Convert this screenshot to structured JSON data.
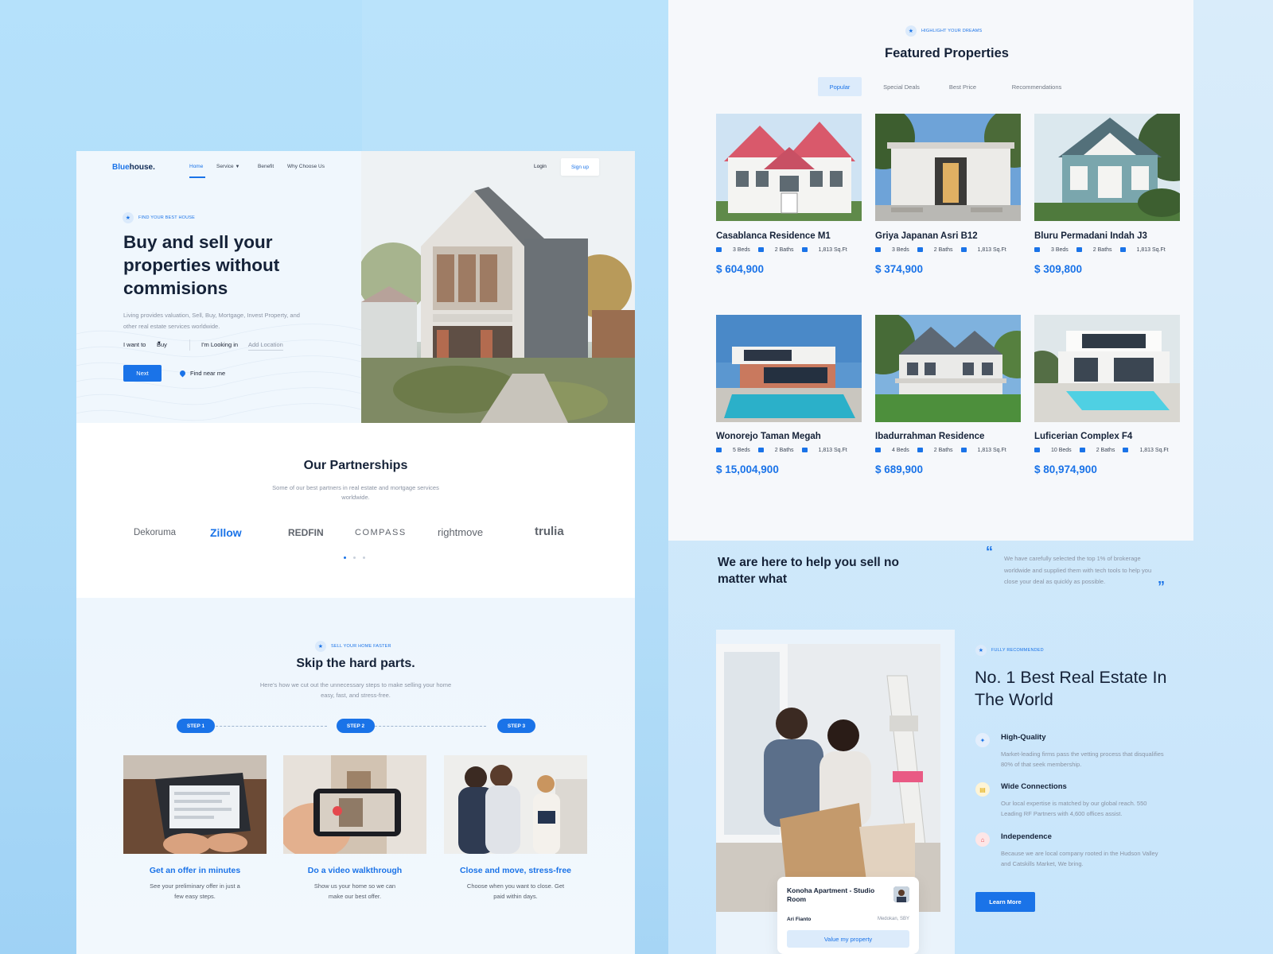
{
  "nav": {
    "logo_prefix": "Blue",
    "logo_suffix": "house.",
    "items": [
      "Home",
      "Service",
      "Benefit",
      "Why Choose Us"
    ],
    "login": "Login",
    "signup": "Sign up"
  },
  "hero": {
    "tag": "FIND YOUR BEST HOUSE",
    "title": "Buy and sell your properties without commisions",
    "description": "Living provides valuation, Sell, Buy, Mortgage, Invest Property, and other real estate services worldwide.",
    "want_label": "I want to",
    "want_value": "Buy",
    "looking_label": "I'm Looking in",
    "location_placeholder": "Add Location",
    "next_button": "Next",
    "find_near": "Find near me"
  },
  "partners": {
    "title": "Our Partnerships",
    "description": "Some of our best partners in real estate and mortgage services worldwide.",
    "logos": [
      "Dekoruma",
      "Zillow",
      "REDFIN",
      "COMPASS",
      "rightmove",
      "trulia"
    ],
    "active_dot": 0
  },
  "steps": {
    "tag": "SELL YOUR HOME FASTER",
    "title": "Skip the hard parts.",
    "description": "Here's how we cut out the unnecessary steps to make selling your home easy, fast, and stress-free.",
    "items": [
      {
        "pill": "STEP 1",
        "title": "Get an offer in minutes",
        "desc": "See your preliminary offer in just a few easy steps."
      },
      {
        "pill": "STEP 2",
        "title": "Do a video walkthrough",
        "desc": "Show us your home so we can make our best offer."
      },
      {
        "pill": "STEP 3",
        "title": "Close and move, stress-free",
        "desc": "Choose when you want to close. Get paid within days."
      }
    ]
  },
  "featured": {
    "tag": "HIGHLIGHT YOUR DREAMS",
    "title": "Featured Properties",
    "tabs": [
      "Popular",
      "Special Deals",
      "Best Price",
      "Recommendations"
    ],
    "active_tab": "Popular",
    "properties": [
      {
        "name": "Casablanca Residence M1",
        "beds": "3 Beds",
        "baths": "2 Baths",
        "area": "1,813 Sq.Ft",
        "price": "$ 604,900"
      },
      {
        "name": "Griya Japanan Asri B12",
        "beds": "3 Beds",
        "baths": "2 Baths",
        "area": "1,813 Sq.Ft",
        "price": "$ 374,900"
      },
      {
        "name": "Bluru Permadani Indah J3",
        "beds": "3 Beds",
        "baths": "2 Baths",
        "area": "1,813 Sq.Ft",
        "price": "$ 309,800"
      },
      {
        "name": "Wonorejo Taman Megah",
        "beds": "5 Beds",
        "baths": "2 Baths",
        "area": "1,813 Sq.Ft",
        "price": "$ 15,004,900"
      },
      {
        "name": "Ibadurrahman Residence",
        "beds": "4 Beds",
        "baths": "2 Baths",
        "area": "1,813 Sq.Ft",
        "price": "$ 689,900"
      },
      {
        "name": "Luficerian Complex F4",
        "beds": "10 Beds",
        "baths": "2 Baths",
        "area": "1,813 Sq.Ft",
        "price": "$ 80,974,900"
      }
    ]
  },
  "help": {
    "title": "We are here to help you sell no matter what",
    "quote": "We have carefully selected the top 1% of brokerage worldwide and supplied them with tech tools to help you close your deal as quickly as possible."
  },
  "apartment_card": {
    "title": "Konoha Apartment - Studio Room",
    "agent": "Ari Fianto",
    "location": "Medokan, SBY",
    "button": "Value my property"
  },
  "best": {
    "tag": "FULLY RECOMMENDED",
    "title": "No. 1 Best Real Estate In The World",
    "features": [
      {
        "name": "High-Quality",
        "desc": "Market-leading firms pass the vetting process that disqualifies 80% of that seek membership.",
        "icon": "badge-icon",
        "color": "#1a73e8"
      },
      {
        "name": "Wide Connections",
        "desc": "Our local expertise is matched by our global reach. 550 Leading RF Partners with 4,600 offices assist.",
        "icon": "folder-icon",
        "color": "#f2b705"
      },
      {
        "name": "Independence",
        "desc": "Because we are local company rooted in the Hudson Valley and Catskills Market, We bring.",
        "icon": "home-icon",
        "color": "#e5484d"
      }
    ],
    "button": "Learn More"
  },
  "colors": {
    "accent": "#1a73e8",
    "dark": "#152238",
    "muted": "#8a93a3"
  }
}
